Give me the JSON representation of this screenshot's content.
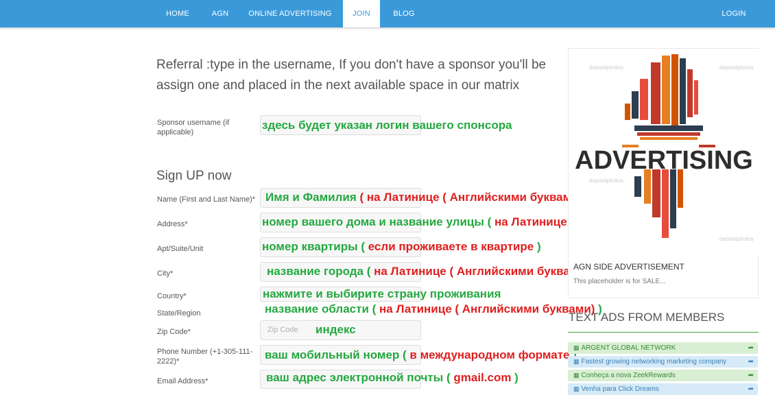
{
  "nav": {
    "home": "HOME",
    "agn": "AGN",
    "online_advertising": "ONLINE ADVERTISING",
    "join": "JOIN",
    "blog": "BLOG",
    "login": "LOGIN"
  },
  "referral": {
    "title": "Referral :type in the username, If you don't have a sponsor you'll be assign one and placed in the next available space in our matrix",
    "sponsor_label": "Sponsor username (if applicable)",
    "sponsor_overlay": "здесь будет указан логин вашего спонсора"
  },
  "signup": {
    "title": "Sign UP now",
    "fields": {
      "name": {
        "label": "Name (First and Last Name)*",
        "overlay_green": "Имя и Фамилия ",
        "overlay_red": "( на Латинице ( Английскими буквами)",
        "overlay_tail": ")"
      },
      "address": {
        "label": "Address*",
        "overlay_green": "номер вашего дома и название улицы ( ",
        "overlay_red": "на Латинице ( Английскими буквами)",
        "overlay_tail": ")"
      },
      "apt": {
        "label": "Apt/Suite/Unit",
        "overlay_green": "номер квартиры ( ",
        "overlay_red": "если проживаете в квартире",
        "overlay_tail": " )"
      },
      "city": {
        "label": "City*",
        "overlay_green": "название города ( ",
        "overlay_red": "на Латинице ( Английскими буквами",
        "overlay_tail": " ))"
      },
      "country": {
        "label": "Country*",
        "overlay_green": "нажмите и выбирите страну проживания"
      },
      "state": {
        "label": "State/Region",
        "overlay_green": "название области ( ",
        "overlay_red": "на Латинице ( Английскими буквами)",
        "overlay_tail": " )"
      },
      "zip": {
        "label": "Zip Code*",
        "placeholder": "Zip Code",
        "overlay_green": "индекс"
      },
      "phone": {
        "label": "Phone Number (+1-305-111-2222)*",
        "overlay_green": "ваш мобильный номер ( ",
        "overlay_red": "в международном формате",
        "overlay_tail": " )"
      },
      "email": {
        "label": "Email Address*",
        "overlay_green": "ваш адрес электронной почты ( ",
        "overlay_red": "gmail.com",
        "overlay_tail": " )"
      }
    }
  },
  "sidebar": {
    "ad_image_text": "ADVERTISING",
    "watermark": "depositphotos",
    "ad_title": "AGN SIDE ADVERTISEMENT",
    "ad_sub": "This placeholder is for SALE...",
    "text_ads_heading": "TEXT ADS FROM MEMBERS",
    "text_ads": [
      {
        "label": "ARGENT GLOBAL NETWORK",
        "bg": "#d9efd3",
        "color": "#3a8a3a"
      },
      {
        "label": "Fastest growing networking marketing company",
        "bg": "#d6eaf7",
        "color": "#3a7fb8"
      },
      {
        "label": "Conheça a nova ZeekRewards",
        "bg": "#d9efd3",
        "color": "#3a8a3a"
      },
      {
        "label": "Venha para Click Dreams",
        "bg": "#d6eaf7",
        "color": "#3a7fb8"
      }
    ]
  },
  "colors": {
    "nav_bg": "#3a9ad9",
    "overlay_green": "#24a83f",
    "overlay_red": "#e01e1e"
  },
  "icons": {
    "grid": "grid-icon",
    "share": "share-icon"
  }
}
